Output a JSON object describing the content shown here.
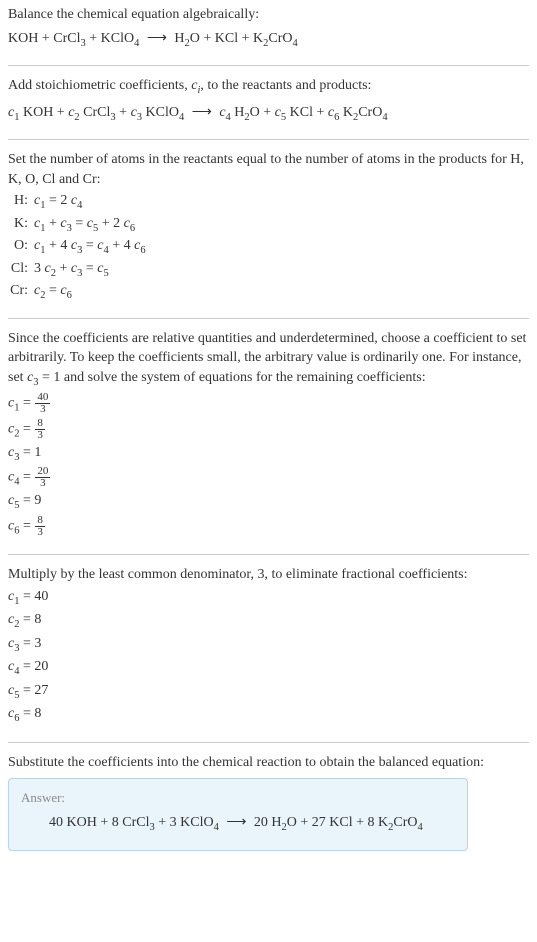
{
  "section1": {
    "intro": "Balance the chemical equation algebraically:",
    "eq_left1": "KOH + CrCl",
    "eq_left2": " + KClO",
    "eq_right1": "H",
    "eq_right2": "O + KCl + K",
    "eq_right3": "CrO"
  },
  "section2": {
    "intro": "Add stoichiometric coefficients, ",
    "intro2": ", to the reactants and products:",
    "ci": "c",
    "ci_sub": "i",
    "c1": "c",
    "s1": "1",
    "r1": " KOH + ",
    "c2": "c",
    "s2": "2",
    "r2": " CrCl",
    "c3": "c",
    "s3": "3",
    "r3": " KClO",
    "c4": "c",
    "s4": "4",
    "r4": " H",
    "c5": "c",
    "s5": "5",
    "r5": " KCl + ",
    "c6": "c",
    "s6": "6",
    "r6": " K",
    "plus": " + ",
    "oPlus": "O + ",
    "cro": "CrO"
  },
  "section3": {
    "intro": "Set the number of atoms in the reactants equal to the number of atoms in the products for H, K, O, Cl and Cr:",
    "rows": {
      "h_label": "H:",
      "h_eq1": "c",
      "h_eq1s": "1",
      "h_eq2": " = 2 ",
      "h_eq3": "c",
      "h_eq3s": "4",
      "k_label": "K:",
      "k_eq1": "c",
      "k_eq1s": "1",
      "k_eq2": " + ",
      "k_eq3": "c",
      "k_eq3s": "3",
      "k_eq4": " = ",
      "k_eq5": "c",
      "k_eq5s": "5",
      "k_eq6": " + 2 ",
      "k_eq7": "c",
      "k_eq7s": "6",
      "o_label": "O:",
      "o_eq1": "c",
      "o_eq1s": "1",
      "o_eq2": " + 4 ",
      "o_eq3": "c",
      "o_eq3s": "3",
      "o_eq4": " = ",
      "o_eq5": "c",
      "o_eq5s": "4",
      "o_eq6": " + 4 ",
      "o_eq7": "c",
      "o_eq7s": "6",
      "cl_label": "Cl:",
      "cl_eq1": "3 ",
      "cl_eq2": "c",
      "cl_eq2s": "2",
      "cl_eq3": " + ",
      "cl_eq4": "c",
      "cl_eq4s": "3",
      "cl_eq5": " = ",
      "cl_eq6": "c",
      "cl_eq6s": "5",
      "cr_label": "Cr:",
      "cr_eq1": "c",
      "cr_eq1s": "2",
      "cr_eq2": " = ",
      "cr_eq3": "c",
      "cr_eq3s": "6"
    }
  },
  "section4": {
    "intro1": "Since the coefficients are relative quantities and underdetermined, choose a coefficient to set arbitrarily. To keep the coefficients small, the arbitrary value is ordinarily one. For instance, set ",
    "intro_c": "c",
    "intro_cs": "3",
    "intro2": " = 1 and solve the system of equations for the remaining coefficients:",
    "c1": "c",
    "c1s": "1",
    "eq": " = ",
    "c1n": "40",
    "c1d": "3",
    "c2": "c",
    "c2s": "2",
    "c2n": "8",
    "c2d": "3",
    "c3": "c",
    "c3s": "3",
    "c3v": " = 1",
    "c4": "c",
    "c4s": "4",
    "c4n": "20",
    "c4d": "3",
    "c5": "c",
    "c5s": "5",
    "c5v": " = 9",
    "c6": "c",
    "c6s": "6",
    "c6n": "8",
    "c6d": "3"
  },
  "section5": {
    "intro": "Multiply by the least common denominator, 3, to eliminate fractional coefficients:",
    "c1": "c",
    "c1s": "1",
    "c1v": " = 40",
    "c2": "c",
    "c2s": "2",
    "c2v": " = 8",
    "c3": "c",
    "c3s": "3",
    "c3v": " = 3",
    "c4": "c",
    "c4s": "4",
    "c4v": " = 20",
    "c5": "c",
    "c5s": "5",
    "c5v": " = 27",
    "c6": "c",
    "c6s": "6",
    "c6v": " = 8"
  },
  "section6": {
    "intro": "Substitute the coefficients into the chemical reaction to obtain the balanced equation:",
    "answer_label": "Answer:",
    "eq1": "40 KOH + 8 CrCl",
    "eq2": " + 3 KClO",
    "eq3": "20 H",
    "eq4": "O + 27 KCl + 8 K",
    "eq5": "CrO"
  },
  "subs": {
    "s2": "2",
    "s3": "3",
    "s4": "4"
  },
  "arrow": "⟶"
}
